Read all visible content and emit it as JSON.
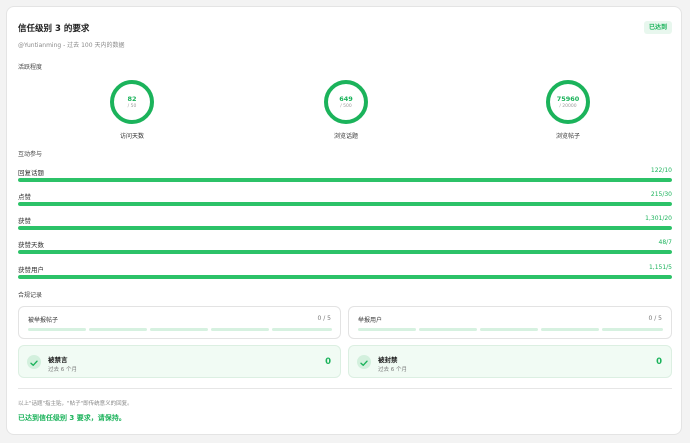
{
  "header": {
    "title": "信任级别 3 的要求",
    "subtitle": "@Yuntianming - 过去 100 天内的数据",
    "badge": "已达到"
  },
  "activity": {
    "label": "活跃程度",
    "rings": [
      {
        "value": "82",
        "total": "/ 50",
        "label": "访问天数",
        "progress": 1.0
      },
      {
        "value": "649",
        "total": "/ 500",
        "label": "浏览话题",
        "progress": 1.0
      },
      {
        "value": "75960",
        "total": "/ 20000",
        "label": "浏览帖子",
        "progress": 1.0
      }
    ]
  },
  "interaction": {
    "label": "互动参与",
    "bars": [
      {
        "label": "回复话题",
        "value": "122/10",
        "progress": 1.0
      },
      {
        "label": "点赞",
        "value": "215/30",
        "progress": 1.0
      },
      {
        "label": "获赞",
        "value": "1,301/20",
        "progress": 1.0
      },
      {
        "label": "获赞天数",
        "value": "48/7",
        "progress": 1.0
      },
      {
        "label": "获赞用户",
        "value": "1,151/5",
        "progress": 1.0
      }
    ]
  },
  "compliance": {
    "label": "合规记录",
    "reported_posts": {
      "title": "被举报帖子",
      "count": "0 / 5"
    },
    "reported_users": {
      "title": "举报用户",
      "count": "0 / 5"
    },
    "muted": {
      "title": "被禁言",
      "sub": "过去 6 个月",
      "value": "0"
    },
    "banned": {
      "title": "被封禁",
      "sub": "过去 6 个月",
      "value": "0"
    }
  },
  "footer": {
    "note": "以上\"话题\"指主贴，\"帖子\"即传统意义的回复。",
    "status": "已达到信任级别 3 要求，请保持。"
  },
  "colors": {
    "accent": "#1bb35b",
    "track": "#d6f1e0",
    "fill": "#2cc268"
  },
  "icons": {
    "check": "check-icon"
  }
}
